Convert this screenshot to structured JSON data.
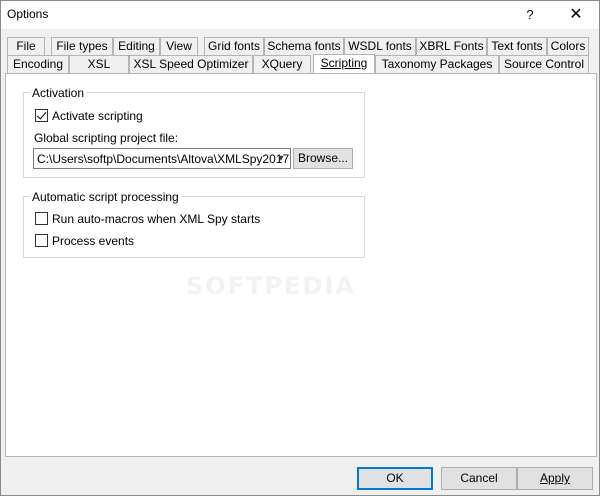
{
  "window": {
    "title": "Options",
    "help_glyph": "?",
    "close_glyph": "✕"
  },
  "tabs": {
    "row1": [
      "File",
      "File types",
      "Editing",
      "View",
      "Grid fonts",
      "Schema fonts",
      "WSDL fonts",
      "XBRL Fonts",
      "Text fonts",
      "Colors"
    ],
    "row2": [
      "Encoding",
      "XSL",
      "XSL Speed Optimizer",
      "XQuery",
      "Scripting",
      "Taxonomy Packages",
      "Source Control"
    ],
    "active": "Scripting"
  },
  "activation": {
    "legend": "Activation",
    "activate_label": "Activate scripting",
    "activate_checked": true,
    "project_file_label": "Global scripting project file:",
    "project_file_value": "C:\\Users\\softp\\Documents\\Altova\\XMLSpy2017",
    "browse_label": "Browse..."
  },
  "automatic": {
    "legend": "Automatic script processing",
    "auto_macros_label": "Run auto-macros when XML Spy starts",
    "auto_macros_checked": false,
    "process_events_label": "Process events",
    "process_events_checked": false
  },
  "watermark": "SOFTPEDIA",
  "footer": {
    "ok_label": "OK",
    "cancel_label": "Cancel",
    "apply_label": "Apply"
  },
  "icons": {
    "dropdown": "chevron-down-icon",
    "checkmark": "checkmark-icon"
  },
  "colors": {
    "focus_border": "#0078d7",
    "dialog_bg": "#f0f0f0"
  }
}
